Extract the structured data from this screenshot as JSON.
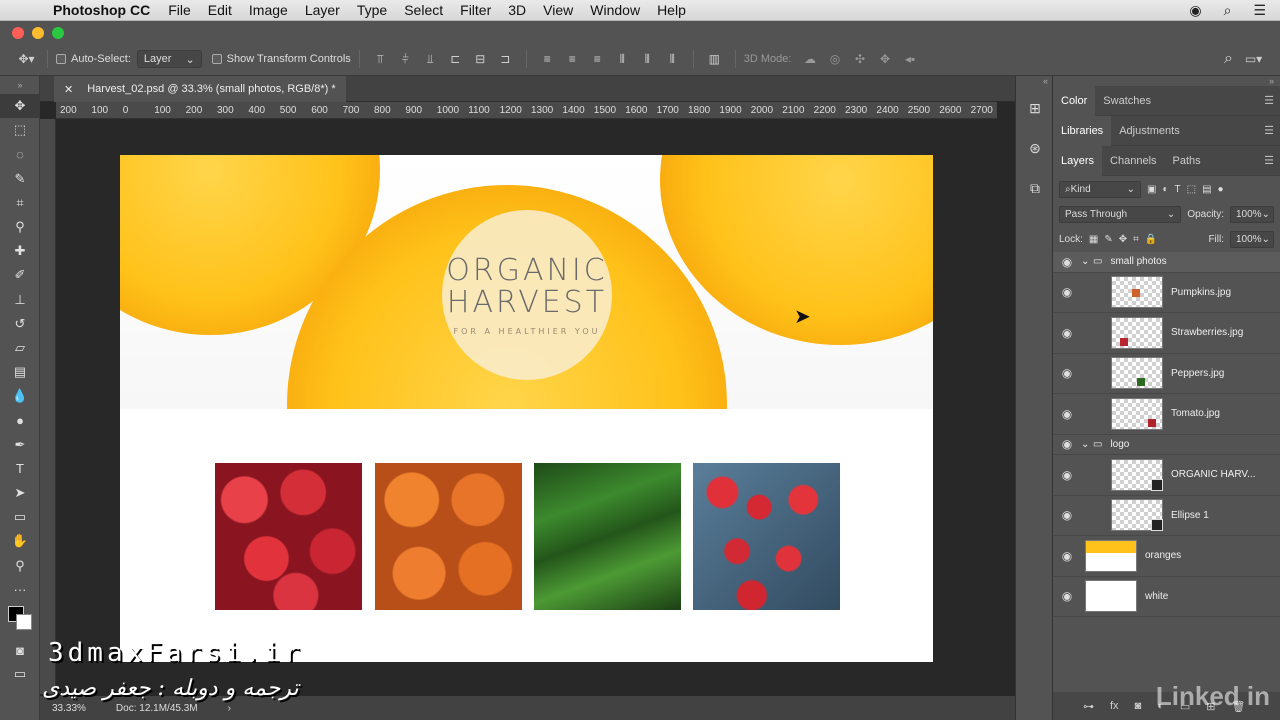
{
  "menubar": {
    "app": "Photoshop CC",
    "items": [
      "File",
      "Edit",
      "Image",
      "Layer",
      "Type",
      "Select",
      "Filter",
      "3D",
      "View",
      "Window",
      "Help"
    ]
  },
  "options": {
    "auto_select_label": "Auto-Select:",
    "auto_select_value": "Layer",
    "show_transform_label": "Show Transform Controls",
    "mode_3d_label": "3D Mode:"
  },
  "document": {
    "tab_title": "Harvest_02.psd @ 33.3% (small photos, RGB/8*) *",
    "ruler_ticks": [
      "200",
      "100",
      "0",
      "100",
      "200",
      "300",
      "400",
      "500",
      "600",
      "700",
      "800",
      "900",
      "1000",
      "1100",
      "1200",
      "1300",
      "1400",
      "1500",
      "1600",
      "1700",
      "1800",
      "1900",
      "2000",
      "2100",
      "2200",
      "2300",
      "2400",
      "2500",
      "2600",
      "2700"
    ],
    "zoom": "33.33%",
    "doc_size": "Doc: 12.1M/45.3M",
    "canvas": {
      "title_line1": "ORGANIC",
      "title_line2": "HARVEST",
      "tagline": "FOR A HEALTHIER YOU"
    }
  },
  "panels": {
    "row1": {
      "tabs": [
        "Color",
        "Swatches"
      ]
    },
    "row2": {
      "tabs": [
        "Libraries",
        "Adjustments"
      ]
    },
    "row3": {
      "tabs": [
        "Layers",
        "Channels",
        "Paths"
      ]
    },
    "filter_kind": "Kind",
    "blend_mode": "Pass Through",
    "opacity_label": "Opacity:",
    "opacity_value": "100%",
    "lock_label": "Lock:",
    "fill_label": "Fill:",
    "fill_value": "100%",
    "layers": [
      {
        "name": "small photos"
      },
      {
        "name": "Pumpkins.jpg"
      },
      {
        "name": "Strawberries.jpg"
      },
      {
        "name": "Peppers.jpg"
      },
      {
        "name": "Tomato.jpg"
      },
      {
        "name": "logo"
      },
      {
        "name": "ORGANIC HARV..."
      },
      {
        "name": "Ellipse 1"
      },
      {
        "name": "oranges"
      },
      {
        "name": "white"
      }
    ]
  },
  "watermarks": {
    "site": "3dmaxFarsi.ir",
    "credit": "ترجمه و دوبله : جعفر صیدی",
    "brand": "Linked in"
  },
  "colors": {
    "menubar_bg": "#e0e0e0",
    "chrome_bg": "#535353",
    "orange": "#ffc21a"
  }
}
